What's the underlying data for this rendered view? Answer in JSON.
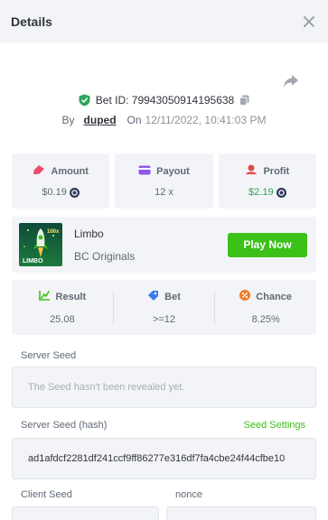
{
  "header": {
    "title": "Details"
  },
  "bet": {
    "id_text": "Bet ID: 79943050914195638",
    "by_label": "By",
    "username": "duped",
    "on_label": "On",
    "date": "12/11/2022, 10:41:03 PM"
  },
  "stats": {
    "amount": {
      "label": "Amount",
      "value": "$0.19"
    },
    "payout": {
      "label": "Payout",
      "value": "12 x"
    },
    "profit": {
      "label": "Profit",
      "value": "$2.19"
    }
  },
  "game": {
    "name": "Limbo",
    "provider": "BC Originals",
    "play_label": "Play Now",
    "thumb_text": "LIMBO",
    "thumb_multiplier": "100x"
  },
  "results": {
    "result": {
      "label": "Result",
      "value": "25.08"
    },
    "bet": {
      "label": "Bet",
      "value": ">=12"
    },
    "chance": {
      "label": "Chance",
      "value": "8.25%"
    }
  },
  "seeds": {
    "server_seed_label": "Server Seed",
    "server_seed_placeholder": "The Seed hasn't been revealed yet.",
    "server_seed_hash_label": "Server Seed (hash)",
    "seed_settings_label": "Seed Settings",
    "server_seed_hash": "ad1afdcf2281df241ccf9ff86277e316df7fa4cbe24f44cfbe10",
    "client_seed_label": "Client Seed",
    "nonce_label": "nonce"
  },
  "colors": {
    "accent_green": "#3bc117",
    "profit_green": "#2fa55b",
    "panel_bg": "#f3f4f7"
  }
}
